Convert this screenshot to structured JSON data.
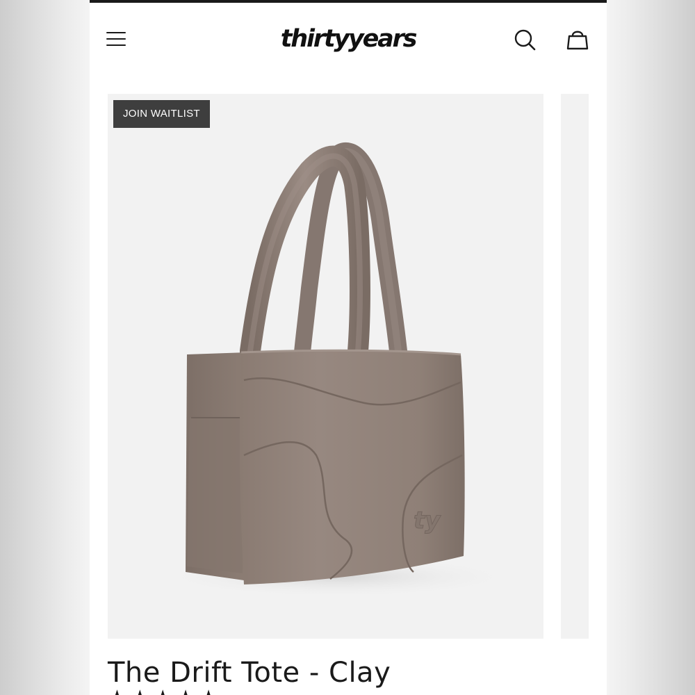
{
  "header": {
    "logo_text": "thirtyyears",
    "menu_icon": "hamburger-menu-icon",
    "search_icon": "search-icon",
    "cart_icon": "shopping-bag-icon"
  },
  "gallery": {
    "badge_label": "JOIN WAITLIST",
    "image_alt": "The Drift Tote - Clay",
    "bag_color": "#8f8077"
  },
  "product": {
    "title": "The Drift Tote - Clay",
    "rating_stars": "★★★★★"
  },
  "colors": {
    "top_border": "#1a1a1a",
    "badge_bg": "#3e3e3e",
    "image_bg": "#f2f2f2"
  }
}
